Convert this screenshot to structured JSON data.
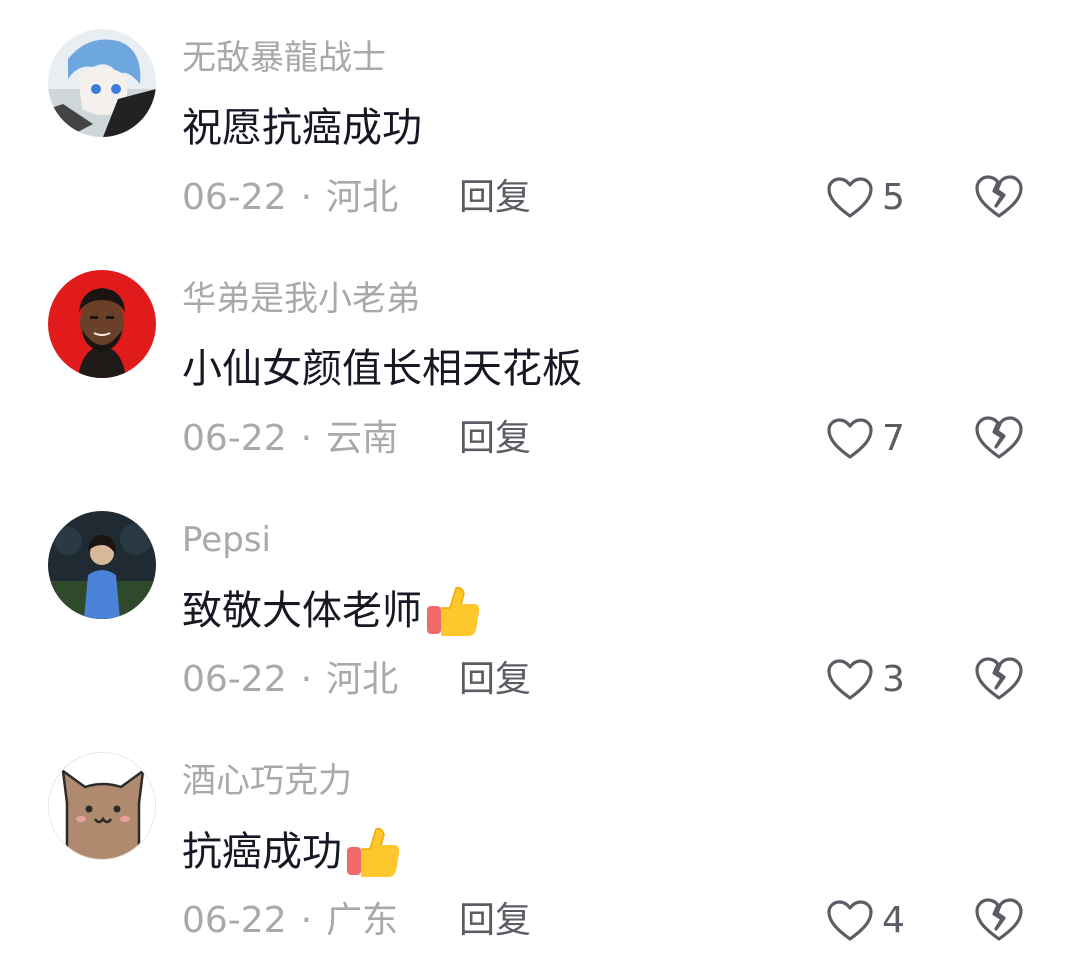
{
  "comments": [
    {
      "username": "无敌暴龍战士",
      "content": "祝愿抗癌成功",
      "date": "06-22",
      "separator": "·",
      "location": "河北",
      "reply_label": "回复",
      "likes": "5",
      "emoji": null
    },
    {
      "username": "华弟是我小老弟",
      "content": "小仙女颜值长相天花板",
      "date": "06-22",
      "separator": "·",
      "location": "云南",
      "reply_label": "回复",
      "likes": "7",
      "emoji": null
    },
    {
      "username": "Pepsi",
      "content": "致敬大体老师",
      "date": "06-22",
      "separator": "·",
      "location": "河北",
      "reply_label": "回复",
      "likes": "3",
      "emoji": "thumbs-up"
    },
    {
      "username": "酒心巧克力",
      "content": "抗癌成功",
      "date": "06-22",
      "separator": "·",
      "location": "广东",
      "reply_label": "回复",
      "likes": "4",
      "emoji": "thumbs-up"
    }
  ],
  "colors": {
    "username": "#a8a8ad",
    "content": "#161823",
    "meta": "#a8a8ad",
    "action": "#5c5d64"
  },
  "icons": {
    "like": "heart-outline-icon",
    "dislike": "broken-heart-icon",
    "emoji": "thumbs-up-emoji"
  }
}
